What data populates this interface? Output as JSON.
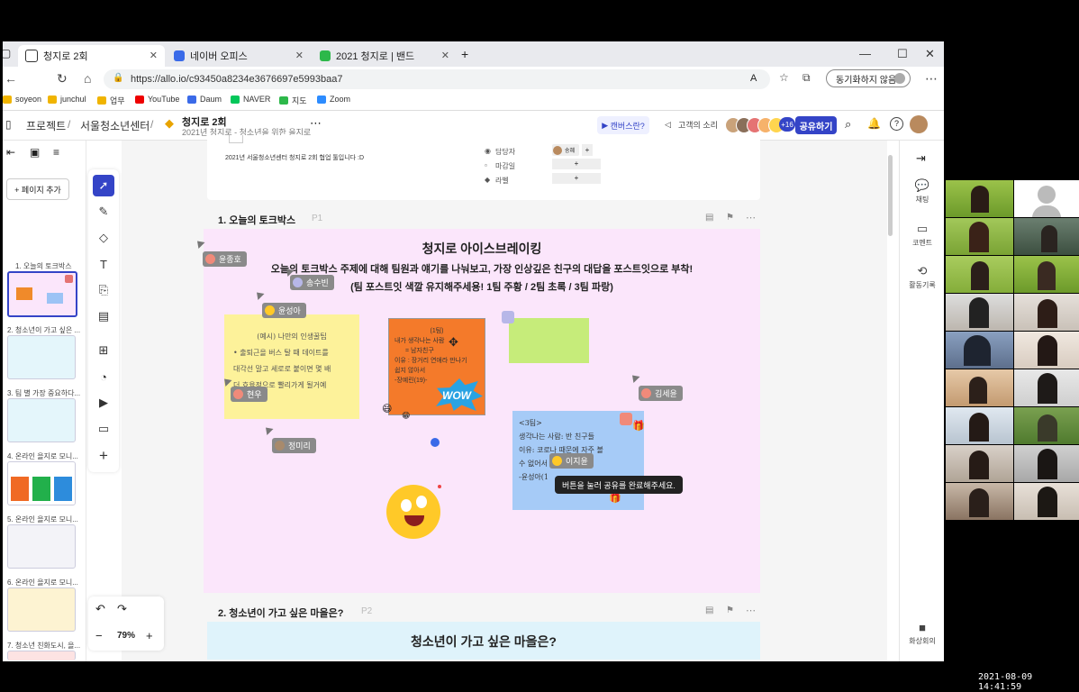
{
  "tabs": [
    {
      "label": "청지로 2회",
      "color": "#222"
    },
    {
      "label": "네이버 오피스",
      "color": "#3a6ae8"
    },
    {
      "label": "2021 청지로 | 밴드",
      "color": "#2db84a"
    }
  ],
  "address": {
    "url": "https://allo.io/c93450a8234e3676697e5993baa7",
    "sync_label": "동기화하지 않음"
  },
  "bookmarks": [
    "soyeon",
    "junchul",
    "업무",
    "YouTube",
    "Daum",
    "NAVER",
    "지도",
    "Zoom"
  ],
  "header": {
    "breadcrumb1": "프로젝트",
    "breadcrumb2": "서울청소년센터",
    "title": "청지로 2회",
    "subtitle": "2021년 청지로 - 청소년을 위한 을지로",
    "canvas_button": "캔버스란?",
    "feedback": "고객의 소리",
    "member_count": "+16",
    "share_button": "공유하기"
  },
  "sidebar": {
    "add_page": "+ 페이지 추가",
    "pages": [
      "1. 오늘의 토크박스",
      "2. 청소년이 가고 싶은 ...",
      "3. 팀 별 가장 중요하다...",
      "4. 온라인 을지로 모니...",
      "5. 온라인 을지로 모니...",
      "6. 온라인 을지로 모니...",
      "7. 청소년 친화도시, 을..."
    ]
  },
  "zoom": "79%",
  "card": {
    "description": "2021년 서울청소년센터 청지로 2회 협업 툴입니다 :D",
    "assignee_label": "담당자",
    "assignee_name": "송혜",
    "due_label": "마감일",
    "label_label": "라벨"
  },
  "section1": {
    "title": "1. 오늘의 토크박스",
    "page": "P1",
    "heading": "청지로 아이스브레이킹",
    "line1": "오늘의 토크박스 주제에 대해 팀원과 얘기를 나눠보고, 가장 인상깊은 친구의 대답을 포스트잇으로 부착!",
    "line2": "(팀 포스트잇 색깔 유지해주세용! 1팀 주황 / 2팀 초록 / 3팀 파랑)"
  },
  "stickies": {
    "yellow": [
      "(예시) 나만의 인생꿀팁",
      "• 출퇴근을 버스 탈 때 데이트를",
      "대각선 말고 세로로 붙이면 몇 배",
      "더 효율적으로 빨리가게 될거예"
    ],
    "orange": [
      "(1팀)",
      "내가 생각나는 사람",
      "= 남자친구",
      "이유 : 장거리 연애라 만나기",
      "쉽지 않아서",
      "-장예린(19)-"
    ],
    "blue": [
      "<3팀>",
      "생각나는 사람: 반 친구들",
      "이유: 코로나 때문에 자주 볼",
      "수 없어서 생각이 난다.",
      "-윤성아(1"
    ]
  },
  "cursors": [
    "윤종호",
    "송수빈",
    "윤성아",
    "현우",
    "정미리",
    "김세윤",
    "이지윤"
  ],
  "tooltip": "버튼을 눌러 공유를 완료해주세요.",
  "section2": {
    "title": "2. 청소년이 가고 싶은 마을은?",
    "page": "P2",
    "heading": "청소년이 가고 싶은 마을은?"
  },
  "rightbar": [
    "채팅",
    "코멘트",
    "활동기록",
    "화상회의"
  ],
  "timestamp": "2021-08-09 14:41:59"
}
